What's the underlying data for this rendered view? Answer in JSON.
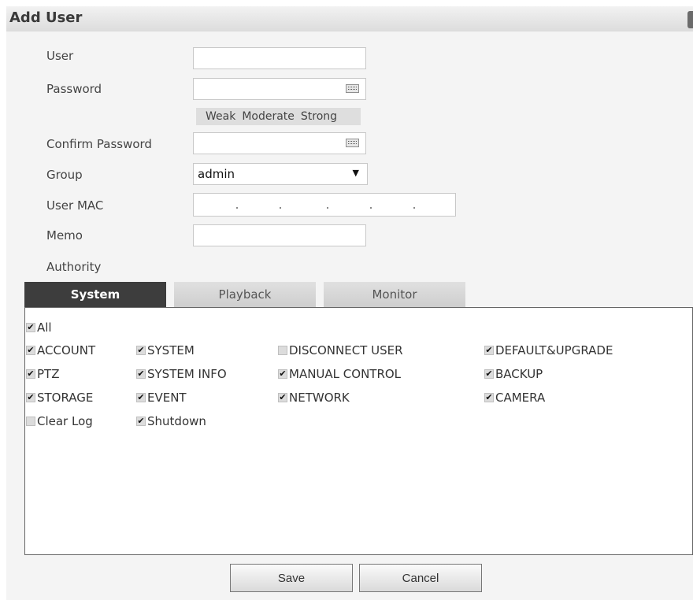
{
  "title": "Add User",
  "form": {
    "user_label": "User",
    "password_label": "Password",
    "strength": [
      "Weak",
      "Moderate",
      "Strong"
    ],
    "confirm_label": "Confirm Password",
    "group_label": "Group",
    "group_value": "admin",
    "mac_label": "User MAC",
    "memo_label": "Memo",
    "authority_label": "Authority"
  },
  "tabs": [
    "System",
    "Playback",
    "Monitor"
  ],
  "permissions": {
    "all": {
      "label": "All",
      "checked": true
    },
    "items": [
      {
        "label": "ACCOUNT",
        "checked": true
      },
      {
        "label": "SYSTEM",
        "checked": true
      },
      {
        "label": "DISCONNECT USER",
        "checked": false
      },
      {
        "label": "DEFAULT&UPGRADE",
        "checked": true
      },
      {
        "label": "PTZ",
        "checked": true
      },
      {
        "label": "SYSTEM INFO",
        "checked": true
      },
      {
        "label": "MANUAL CONTROL",
        "checked": true
      },
      {
        "label": "BACKUP",
        "checked": true
      },
      {
        "label": "STORAGE",
        "checked": true
      },
      {
        "label": "EVENT",
        "checked": true
      },
      {
        "label": "NETWORK",
        "checked": true
      },
      {
        "label": "CAMERA",
        "checked": true
      },
      {
        "label": "Clear Log",
        "checked": false
      },
      {
        "label": "Shutdown",
        "checked": true
      }
    ]
  },
  "buttons": {
    "save": "Save",
    "cancel": "Cancel"
  }
}
